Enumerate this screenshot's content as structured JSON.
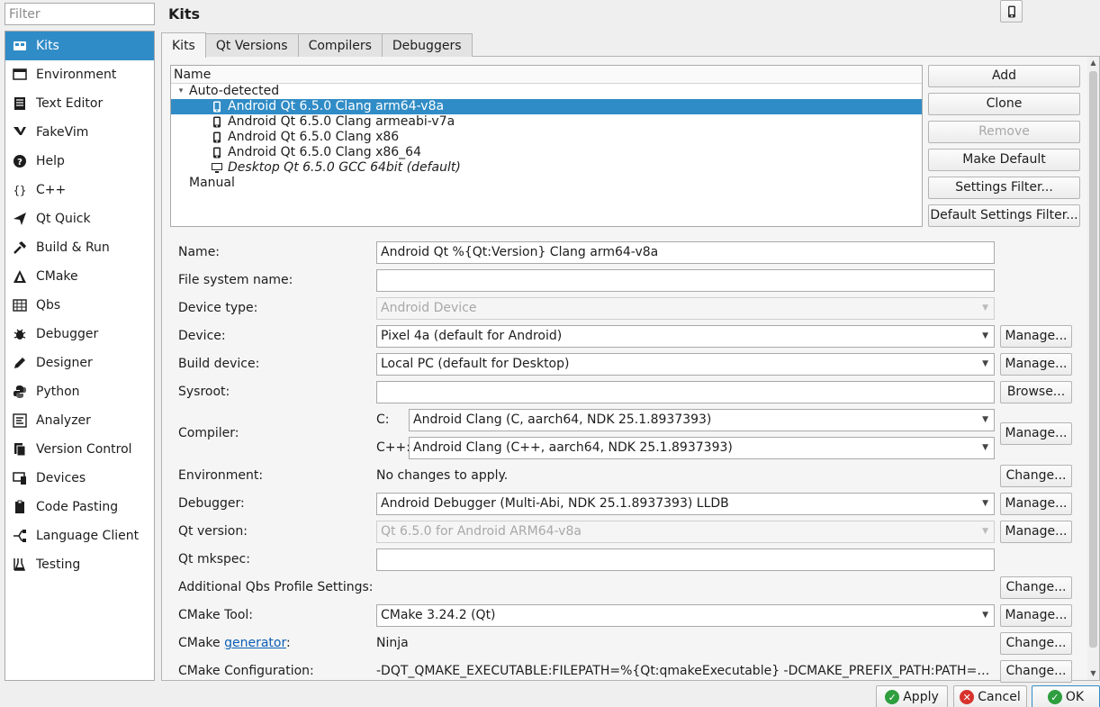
{
  "filter": {
    "placeholder": "Filter"
  },
  "sidebar": {
    "items": [
      {
        "label": "Kits",
        "icon": "kits-icon",
        "selected": true
      },
      {
        "label": "Environment",
        "icon": "environment-icon"
      },
      {
        "label": "Text Editor",
        "icon": "text-editor-icon"
      },
      {
        "label": "FakeVim",
        "icon": "fakevim-icon"
      },
      {
        "label": "Help",
        "icon": "help-icon"
      },
      {
        "label": "C++",
        "icon": "braces-icon"
      },
      {
        "label": "Qt Quick",
        "icon": "qt-quick-icon"
      },
      {
        "label": "Build & Run",
        "icon": "hammer-icon"
      },
      {
        "label": "CMake",
        "icon": "cmake-icon"
      },
      {
        "label": "Qbs",
        "icon": "qbs-icon"
      },
      {
        "label": "Debugger",
        "icon": "bug-icon"
      },
      {
        "label": "Designer",
        "icon": "pencil-icon"
      },
      {
        "label": "Python",
        "icon": "python-icon"
      },
      {
        "label": "Analyzer",
        "icon": "analyzer-icon"
      },
      {
        "label": "Version Control",
        "icon": "version-control-icon"
      },
      {
        "label": "Devices",
        "icon": "devices-icon"
      },
      {
        "label": "Code Pasting",
        "icon": "code-pasting-icon"
      },
      {
        "label": "Language Client",
        "icon": "language-client-icon"
      },
      {
        "label": "Testing",
        "icon": "flask-icon"
      }
    ]
  },
  "page_title": "Kits",
  "tabs": [
    {
      "label": "Kits",
      "active": true
    },
    {
      "label": "Qt Versions"
    },
    {
      "label": "Compilers"
    },
    {
      "label": "Debuggers"
    }
  ],
  "tree": {
    "header": "Name",
    "groups": [
      {
        "label": "Auto-detected",
        "expanded": true,
        "children": [
          {
            "label": "Android Qt 6.5.0 Clang arm64-v8a",
            "selected": true,
            "device": "android"
          },
          {
            "label": "Android Qt 6.5.0 Clang armeabi-v7a",
            "device": "android"
          },
          {
            "label": "Android Qt 6.5.0 Clang x86",
            "device": "android"
          },
          {
            "label": "Android Qt 6.5.0 Clang x86_64",
            "device": "android"
          },
          {
            "label": "Desktop Qt 6.5.0 GCC 64bit (default)",
            "device": "desktop",
            "italic": true
          }
        ]
      },
      {
        "label": "Manual",
        "expanded": false,
        "children": []
      }
    ]
  },
  "buttons": {
    "add": "Add",
    "clone": "Clone",
    "remove": "Remove",
    "make_default": "Make Default",
    "settings_filter": "Settings Filter...",
    "default_settings_filter": "Default Settings Filter..."
  },
  "form": {
    "name": {
      "label": "Name:",
      "value": "Android Qt %{Qt:Version} Clang arm64-v8a"
    },
    "fs_name": {
      "label": "File system name:",
      "value": ""
    },
    "device_type": {
      "label": "Device type:",
      "value": "Android Device"
    },
    "device": {
      "label": "Device:",
      "value": "Pixel 4a (default for Android)"
    },
    "build_device": {
      "label": "Build device:",
      "value": "Local PC (default for Desktop)"
    },
    "sysroot": {
      "label": "Sysroot:",
      "value": ""
    },
    "compiler": {
      "label": "Compiler:",
      "c_label": "C:",
      "c_value": "Android Clang (C, aarch64, NDK 25.1.8937393)",
      "cpp_label": "C++:",
      "cpp_value": "Android Clang (C++, aarch64, NDK 25.1.8937393)"
    },
    "environment": {
      "label": "Environment:",
      "value": "No changes to apply."
    },
    "debugger": {
      "label": "Debugger:",
      "value": "Android Debugger (Multi-Abi, NDK 25.1.8937393) LLDB"
    },
    "qt_version": {
      "label": "Qt version:",
      "value": "Qt 6.5.0 for Android ARM64-v8a"
    },
    "qt_mkspec": {
      "label": "Qt mkspec:",
      "value": ""
    },
    "qbs_profile": {
      "label": "Additional Qbs Profile Settings:"
    },
    "cmake_tool": {
      "label": "CMake Tool:",
      "value": "CMake 3.24.2 (Qt)"
    },
    "cmake_generator": {
      "label_prefix": "CMake ",
      "label_link": "generator",
      "label_suffix": ":",
      "value": "Ninja"
    },
    "cmake_config": {
      "label": "CMake Configuration:",
      "value": "-DQT_QMAKE_EXECUTABLE:FILEPATH=%{Qt:qmakeExecutable} -DCMAKE_PREFIX_PATH:PATH=%{…"
    }
  },
  "row_buttons": {
    "manage": "Manage...",
    "browse": "Browse...",
    "change": "Change..."
  },
  "dialog_buttons": {
    "apply": "Apply",
    "cancel": "Cancel",
    "ok": "OK"
  },
  "colors": {
    "accent": "#308cc6",
    "apply_icon": "#2e9e3e",
    "cancel_icon": "#d8322c",
    "link": "#0a5fb4"
  }
}
